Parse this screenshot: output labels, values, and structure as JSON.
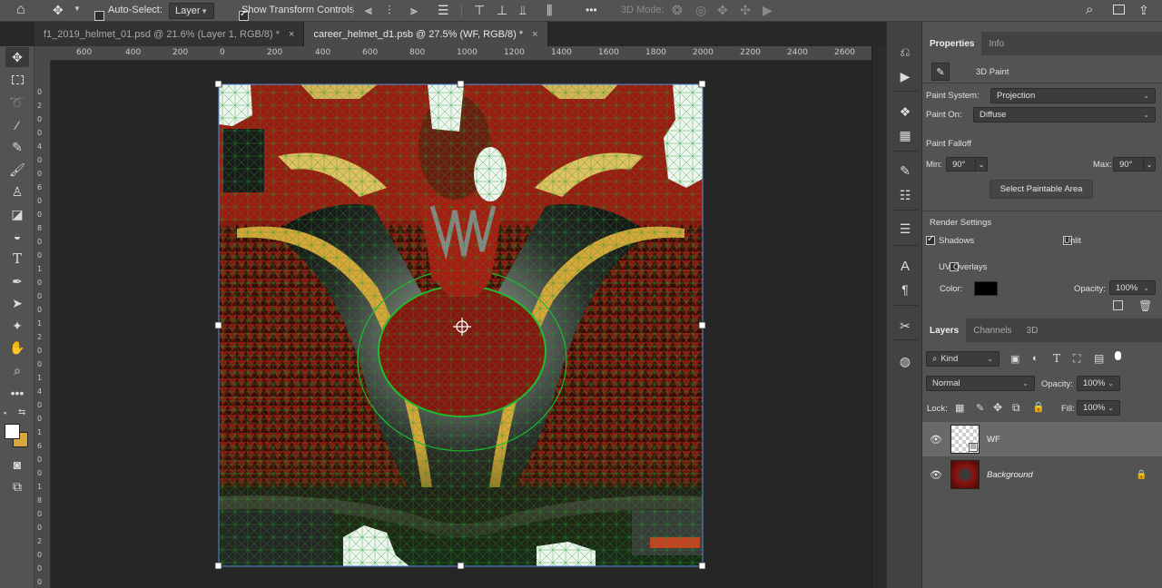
{
  "options_bar": {
    "auto_select_label": "Auto-Select:",
    "auto_select_target": "Layer",
    "show_transform_label": "Show Transform Controls",
    "mode_3d_label": "3D Mode:",
    "more_label": "•••"
  },
  "tabs": [
    {
      "title": "f1_2019_helmet_01.psd @ 21.6% (Layer 1, RGB/8) *",
      "close": "×"
    },
    {
      "title": "career_helmet_d1.psb @ 27.5% (WF, RGB/8) *",
      "close": "×"
    }
  ],
  "ruler": {
    "h_ticks": [
      "600",
      "400",
      "200",
      "0",
      "200",
      "400",
      "600",
      "800",
      "1000",
      "1200",
      "1400",
      "1600",
      "1800",
      "2000",
      "2200",
      "2400",
      "2600"
    ],
    "v_ticks": [
      "0",
      "2",
      "0",
      "0",
      "4",
      "0",
      "0",
      "6",
      "0",
      "0",
      "8",
      "0",
      "0",
      "1",
      "0",
      "0",
      "0",
      "1",
      "2",
      "0",
      "0",
      "1",
      "4",
      "0",
      "0",
      "1",
      "6",
      "0",
      "0",
      "1",
      "8",
      "0",
      "0",
      "2",
      "0",
      "0",
      "0"
    ]
  },
  "properties_panel": {
    "tabs": [
      "Properties",
      "Info"
    ],
    "section_title": "3D Paint",
    "paint_system_label": "Paint System:",
    "paint_system_value": "Projection",
    "paint_on_label": "Paint On:",
    "paint_on_value": "Diffuse",
    "paint_falloff_label": "Paint Falloff",
    "min_label": "Min:",
    "min_value": "90°",
    "max_label": "Max:",
    "max_value": "90°",
    "select_paintable_area": "Select Paintable Area",
    "render_settings_label": "Render Settings",
    "shadows_label": "Shadows",
    "unlit_label": "Unlit",
    "uv_overlays_label": "UV Overlays",
    "color_label": "Color:",
    "opacity_label": "Opacity:",
    "opacity_value": "100%"
  },
  "layers_panel": {
    "tabs": [
      "Layers",
      "Channels",
      "3D"
    ],
    "filter_kind": "Kind",
    "blend_mode": "Normal",
    "opacity_label": "Opacity:",
    "opacity_value": "100%",
    "lock_label": "Lock:",
    "fill_label": "Fill:",
    "fill_value": "100%",
    "layers": [
      {
        "name": "WF",
        "visible": true,
        "selected": true
      },
      {
        "name": "Background",
        "visible": true,
        "locked": true
      }
    ]
  },
  "icons": {
    "toolbar": [
      "move-icon",
      "marquee-icon",
      "lasso-icon",
      "magic-wand-icon",
      "eyedropper-icon",
      "brush-icon",
      "stamp-icon",
      "eraser-icon",
      "bucket-icon",
      "type-icon",
      "pen-icon",
      "path-select-icon",
      "shape-icon",
      "hand-icon",
      "zoom-icon",
      "more-tools-icon"
    ],
    "dock": [
      "history-icon",
      "actions-play-icon",
      "3d-materials-icon",
      "grid-icon",
      "brush-settings-icon",
      "adjustments-icon",
      "properties-icon",
      "character-icon",
      "paragraph-icon",
      "tools-icon",
      "layer-comps-icon"
    ]
  },
  "colors": {
    "foreground": "#ffffff",
    "background": "#d8a63a",
    "uv_overlay_color": "#000000"
  }
}
